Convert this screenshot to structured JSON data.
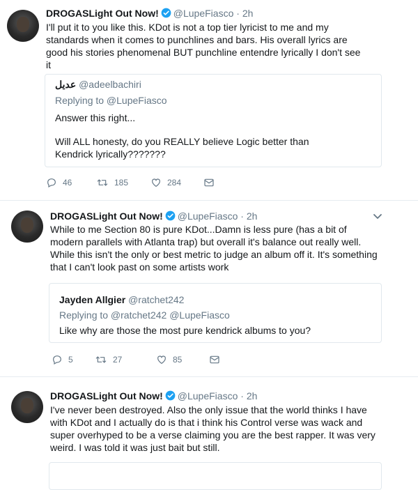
{
  "tweets": [
    {
      "display_name": "DROGASLight Out Now!",
      "handle": "@LupeFiasco",
      "time": "2h",
      "text": "I'll put it to you like this. KDot is not a top tier lyricist to me and my standards when it comes to punchlines and bars. His overall lyrics are good his stories phenomenal BUT punchline entendre lyrically I don't see it",
      "quote": {
        "name": "عديل",
        "handle": "@adeelbachiri",
        "replying_to": "Replying to @LupeFiasco",
        "line1": "Answer this right...",
        "line2": "Will ALL honesty, do you REALLY believe Logic better than Kendrick lyrically???????"
      },
      "replies": "46",
      "retweets": "185",
      "likes": "284"
    },
    {
      "display_name": "DROGASLight Out Now!",
      "handle": "@LupeFiasco",
      "time": "2h",
      "text": "While to me Section 80 is pure KDot...Damn is less pure (has a bit of modern parallels with Atlanta trap) but overall it's balance out really well. While this isn't the only or best metric to judge an album off it. It's something that I can't look past on some artists work",
      "quote": {
        "name": "Jayden Allgier",
        "handle": "@ratchet242",
        "replying_to": "Replying to @ratchet242 @LupeFiasco",
        "line1": "Like why are those the most pure kendrick albums to you?"
      },
      "replies": "5",
      "retweets": "27",
      "likes": "85"
    },
    {
      "display_name": "DROGASLight Out Now!",
      "handle": "@LupeFiasco",
      "time": "2h",
      "text": "I've never been destroyed. Also the only issue that the world thinks I have with KDot and I actually do is that i think his Control verse was wack and super overhyped to be a verse claiming you are the best rapper. It was very weird. I was told it was just bait but still."
    }
  ],
  "colors": {
    "verified": "#1da1f2",
    "muted": "#657786",
    "border": "#e1e8ed"
  },
  "icons": [
    "reply-icon",
    "retweet-icon",
    "like-icon",
    "dm-icon",
    "verified-badge-icon",
    "chevron-down-icon"
  ]
}
